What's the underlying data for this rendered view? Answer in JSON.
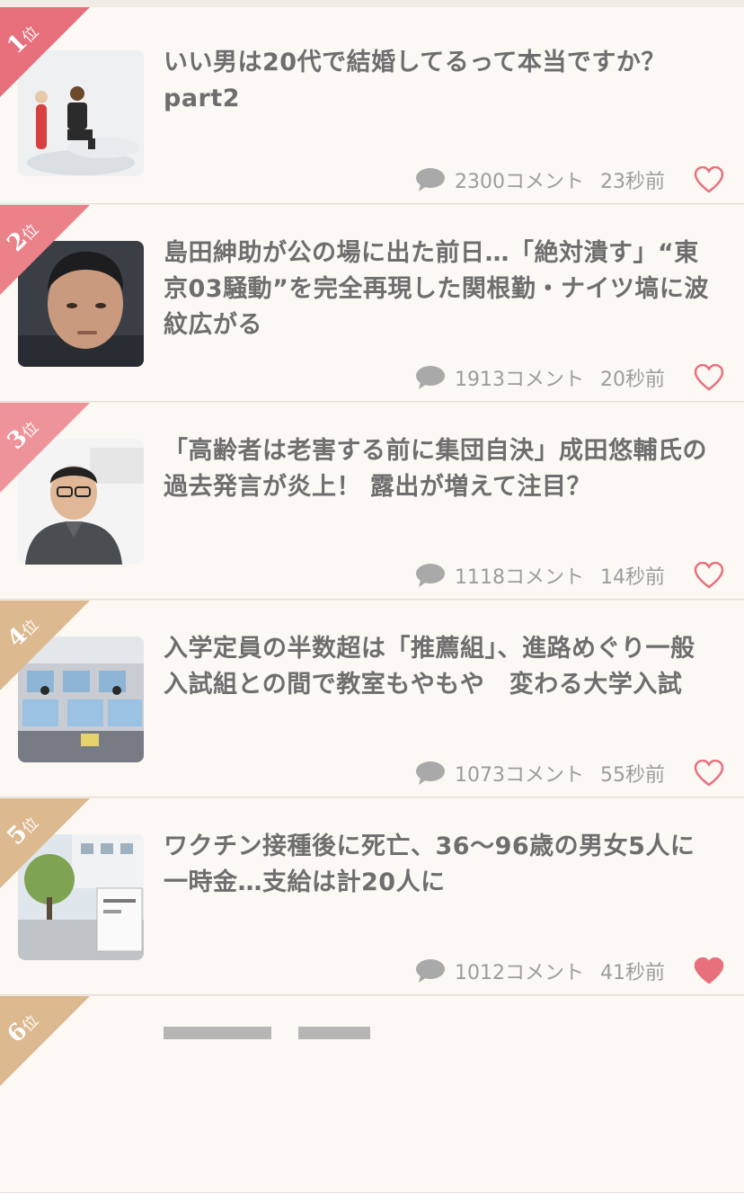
{
  "ranking": [
    {
      "rank_number": "1",
      "rank_suffix": "位",
      "rank_color": "#e8707c",
      "title": "いい男は20代で結婚してるって本当ですか？part2",
      "comment_count": "2300コメント",
      "time_ago": "23秒前",
      "favorited": false
    },
    {
      "rank_number": "2",
      "rank_suffix": "位",
      "rank_color": "#eb8189",
      "title": "島田紳助が公の場に出た前日…「絶対潰す」“東京03騒動”を完全再現した関根勤・ナイツ塙に波紋広がる",
      "comment_count": "1913コメント",
      "time_ago": "20秒前",
      "favorited": false
    },
    {
      "rank_number": "3",
      "rank_suffix": "位",
      "rank_color": "#ee939a",
      "title": "「高齢者は老害する前に集団自決」成田悠輔氏の過去発言が炎上！ 露出が増えて注目？",
      "comment_count": "1118コメント",
      "time_ago": "14秒前",
      "favorited": false
    },
    {
      "rank_number": "4",
      "rank_suffix": "位",
      "rank_color": "#dcb98f",
      "title": "入学定員の半数超は「推薦組」、進路めぐり一般入試組との間で教室もやもや　変わる大学入試",
      "comment_count": "1073コメント",
      "time_ago": "55秒前",
      "favorited": false
    },
    {
      "rank_number": "5",
      "rank_suffix": "位",
      "rank_color": "#dcb98f",
      "title": "ワクチン接種後に死亡、36〜96歳の男女5人に一時金…支給は計20人に",
      "comment_count": "1012コメント",
      "time_ago": "41秒前",
      "favorited": true
    },
    {
      "rank_number": "6",
      "rank_suffix": "位",
      "rank_color": "#dcb98f"
    }
  ],
  "colors": {
    "background": "#fcf8f4",
    "title_text": "#6e6e6e",
    "meta_text": "#9c9c9c",
    "heart": "#e8707c"
  },
  "icons": {
    "comment": "speech-bubble-icon",
    "favorite": "heart-icon"
  }
}
